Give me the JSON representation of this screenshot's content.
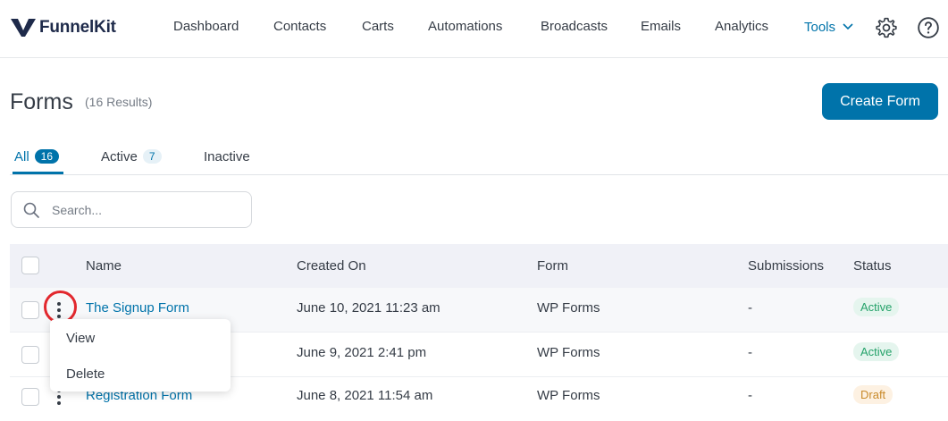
{
  "brand": {
    "name": "FunnelKit"
  },
  "nav": {
    "items": [
      "Dashboard",
      "Contacts",
      "Carts",
      "Automations",
      "Broadcasts",
      "Emails",
      "Analytics"
    ],
    "tools_label": "Tools",
    "icons": [
      "gear-icon",
      "help-icon"
    ]
  },
  "page": {
    "title": "Forms",
    "count": "(16 Results)",
    "create_button": "Create Form"
  },
  "tabs": [
    {
      "label": "All",
      "count": "16",
      "selected": true
    },
    {
      "label": "Active",
      "count": "7",
      "selected": false
    },
    {
      "label": "Inactive",
      "count": "",
      "selected": false
    }
  ],
  "search": {
    "placeholder": "Search...",
    "value": ""
  },
  "table": {
    "columns": [
      "Name",
      "Created On",
      "Form",
      "Submissions",
      "Status"
    ],
    "rows": [
      {
        "name": "The Signup Form",
        "created": "June 10, 2021 11:23 am",
        "form": "WP Forms",
        "submissions": "-",
        "status": "Active"
      },
      {
        "name": "",
        "created": "June 9, 2021 2:41 pm",
        "form": "WP Forms",
        "submissions": "-",
        "status": "Active"
      },
      {
        "name": "Registration Form",
        "created": "June 8, 2021 11:54 am",
        "form": "WP Forms",
        "submissions": "-",
        "status": "Draft"
      }
    ]
  },
  "row_menu": {
    "items": [
      "View",
      "Delete"
    ]
  },
  "colors": {
    "accent": "#0073aa",
    "highlight": "#e2282e",
    "active_text": "#25a26a",
    "draft_text": "#c98a2a"
  }
}
